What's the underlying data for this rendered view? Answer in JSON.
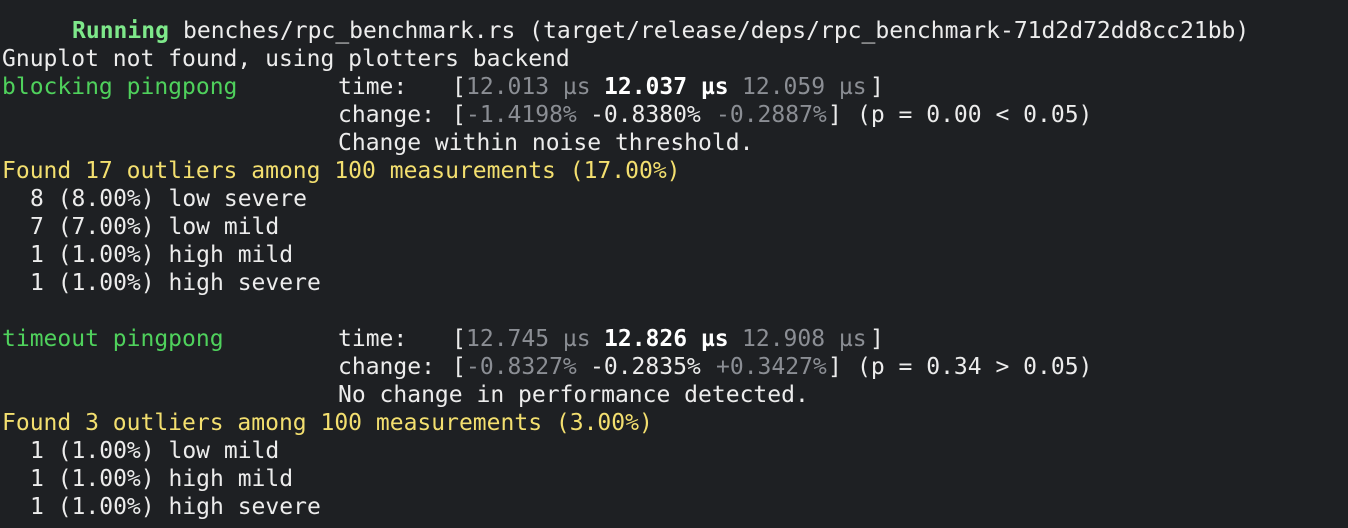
{
  "terminal": {
    "running": {
      "keyword": "Running",
      "target": "benches/rpc_benchmark.rs (target/release/deps/rpc_benchmark-71d2d72dd8cc21bb)"
    },
    "gnuplot_msg": "Gnuplot not found, using plotters backend",
    "benchmarks": [
      {
        "name": "blocking pingpong",
        "time_label": "time:",
        "time_open": "[",
        "time_low": "12.013 µs",
        "time_mid": "12.037 µs",
        "time_high": "12.059 µs",
        "time_close": "]",
        "change_label": "change:",
        "change_open": "[",
        "change_low": "-1.4198%",
        "change_mid": "-0.8380%",
        "change_high": "-0.2887%",
        "change_close": "]",
        "p_value": "(p = 0.00 < 0.05)",
        "verdict": "Change within noise threshold.",
        "outliers_summary": "Found 17 outliers among 100 measurements (17.00%)",
        "outliers": [
          "8 (8.00%) low severe",
          "7 (7.00%) low mild",
          "1 (1.00%) high mild",
          "1 (1.00%) high severe"
        ]
      },
      {
        "name": "timeout pingpong",
        "time_label": "time:",
        "time_open": "[",
        "time_low": "12.745 µs",
        "time_mid": "12.826 µs",
        "time_high": "12.908 µs",
        "time_close": "]",
        "change_label": "change:",
        "change_open": "[",
        "change_low": "-0.8327%",
        "change_mid": "-0.2835%",
        "change_high": "+0.3427%",
        "change_close": "]",
        "p_value": "(p = 0.34 > 0.05)",
        "verdict": "No change in performance detected.",
        "outliers_summary": "Found 3 outliers among 100 measurements (3.00%)",
        "outliers": [
          "1 (1.00%) low mild",
          "1 (1.00%) high mild",
          "1 (1.00%) high severe"
        ]
      }
    ]
  },
  "colors": {
    "background": "#1e2023",
    "text": "#e8e8e8",
    "green": "#4fd15c",
    "yellow": "#f3df6f",
    "dim": "#8b8e94"
  }
}
